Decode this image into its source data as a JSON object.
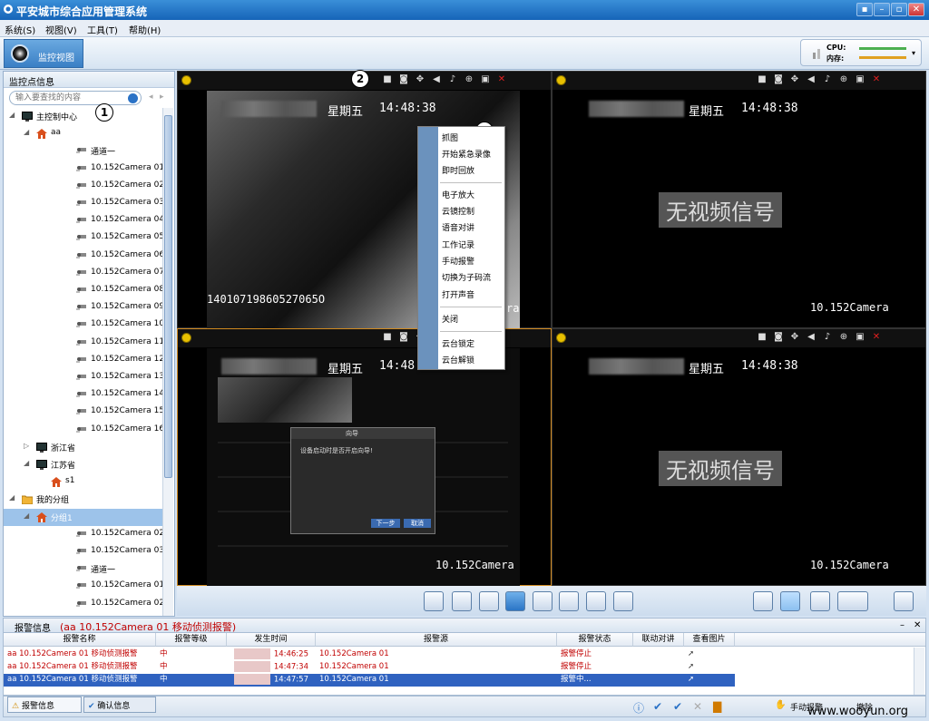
{
  "app": {
    "title": "平安城市综合应用管理系统"
  },
  "window_buttons": [
    "▪",
    "–",
    "▫",
    "✕"
  ],
  "menu": [
    "系统(S)",
    "视图(V)",
    "工具(T)",
    "帮助(H)"
  ],
  "toolbar": {
    "tab_label": "监控视图",
    "cpu_label": "CPU:",
    "mem_label": "内存:"
  },
  "left_panel": {
    "title": "监控点信息",
    "search_placeholder": "输入要查找的内容",
    "tree": [
      {
        "label": "主控制中心",
        "level": 0,
        "icon": "monitor"
      },
      {
        "label": "aa",
        "level": 1,
        "icon": "home"
      },
      {
        "label": "通道一",
        "level": 2,
        "icon": "camera"
      },
      {
        "label": "10.152Camera 01",
        "level": 2,
        "icon": "camera"
      },
      {
        "label": "10.152Camera 02",
        "level": 2,
        "icon": "camera"
      },
      {
        "label": "10.152Camera 03",
        "level": 2,
        "icon": "camera"
      },
      {
        "label": "10.152Camera 04",
        "level": 2,
        "icon": "camera"
      },
      {
        "label": "10.152Camera 05",
        "level": 2,
        "icon": "camera"
      },
      {
        "label": "10.152Camera 06",
        "level": 2,
        "icon": "camera"
      },
      {
        "label": "10.152Camera 07",
        "level": 2,
        "icon": "camera"
      },
      {
        "label": "10.152Camera 08",
        "level": 2,
        "icon": "camera"
      },
      {
        "label": "10.152Camera 09",
        "level": 2,
        "icon": "camera"
      },
      {
        "label": "10.152Camera 10",
        "level": 2,
        "icon": "camera"
      },
      {
        "label": "10.152Camera 11",
        "level": 2,
        "icon": "camera"
      },
      {
        "label": "10.152Camera 12",
        "level": 2,
        "icon": "camera"
      },
      {
        "label": "10.152Camera 13",
        "level": 2,
        "icon": "camera"
      },
      {
        "label": "10.152Camera 14",
        "level": 2,
        "icon": "camera"
      },
      {
        "label": "10.152Camera 15",
        "level": 2,
        "icon": "camera"
      },
      {
        "label": "10.152Camera 16",
        "level": 2,
        "icon": "camera"
      },
      {
        "label": "浙江省",
        "level": 1,
        "icon": "monitor"
      },
      {
        "label": "江苏省",
        "level": 1,
        "icon": "monitor"
      },
      {
        "label": "s1",
        "level": 2,
        "icon": "home"
      },
      {
        "label": "我的分组",
        "level": 0,
        "icon": "folder"
      },
      {
        "label": "分组1",
        "level": 1,
        "icon": "home",
        "selected": true
      },
      {
        "label": "10.152Camera 02",
        "level": 2,
        "icon": "camera"
      },
      {
        "label": "10.152Camera 03",
        "level": 2,
        "icon": "camera"
      },
      {
        "label": "通道一",
        "level": 2,
        "icon": "camera"
      },
      {
        "label": "10.152Camera 01",
        "level": 2,
        "icon": "camera"
      },
      {
        "label": "10.152Camera 02",
        "level": 2,
        "icon": "camera"
      }
    ]
  },
  "callouts": [
    "1",
    "2",
    "3"
  ],
  "panes": [
    {
      "weekday": "星期五",
      "time": "14:48:38",
      "id_text": "14010719860527065O",
      "cam": "ra"
    },
    {
      "weekday": "星期五",
      "time": "14:48:38",
      "novideo": "无视频信号",
      "cam": "10.152Camera"
    },
    {
      "weekday": "星期五",
      "time": "14:48",
      "cam": "10.152Camera",
      "dialog_title": "向导",
      "dialog_text": "设备启动时是否开启向导!",
      "dialog_next": "下一步",
      "dialog_cancel": "取消"
    },
    {
      "weekday": "星期五",
      "time": "14:48:38",
      "novideo": "无视频信号",
      "cam": "10.152Camera"
    }
  ],
  "context_menu": {
    "group1": [
      "抓图",
      "开始紧急录像",
      "即时回放"
    ],
    "group2": [
      "电子放大",
      "云镜控制",
      "语音对讲",
      "工作记录",
      "手动报警",
      "切换为子码流",
      "打开声音"
    ],
    "group3": [
      "关闭"
    ],
    "group4": [
      "云台锁定",
      "云台解锁"
    ]
  },
  "alarm": {
    "header_label": "报警信息",
    "header_detail": "(aa 10.152Camera 01 移动侦测报警)",
    "columns": [
      "报警名称",
      "报警等级",
      "发生时间",
      "报警源",
      "报警状态",
      "联动对讲",
      "查看图片"
    ],
    "rows": [
      {
        "name": "aa 10.152Camera 01 移动侦测报警",
        "level": "中",
        "time": "14:46:25",
        "source": "10.152Camera 01",
        "status": "报警停止",
        "selected": false
      },
      {
        "name": "aa 10.152Camera 01 移动侦测报警",
        "level": "中",
        "time": "14:47:34",
        "source": "10.152Camera 01",
        "status": "报警停止",
        "selected": false
      },
      {
        "name": "aa 10.152Camera 01 移动侦测报警",
        "level": "中",
        "time": "14:47:57",
        "source": "10.152Camera 01",
        "status": "报警中...",
        "selected": true
      }
    ]
  },
  "bottom": {
    "tab1": "报警信息",
    "tab2": "确认信息",
    "manual_alarm": "手动报警",
    "clear": "撤除"
  },
  "watermark": "www.wooyun.org",
  "colors": {
    "title_bar": "#1f6fc4",
    "alarm_text": "#c00000",
    "selection": "#2f62c0"
  }
}
